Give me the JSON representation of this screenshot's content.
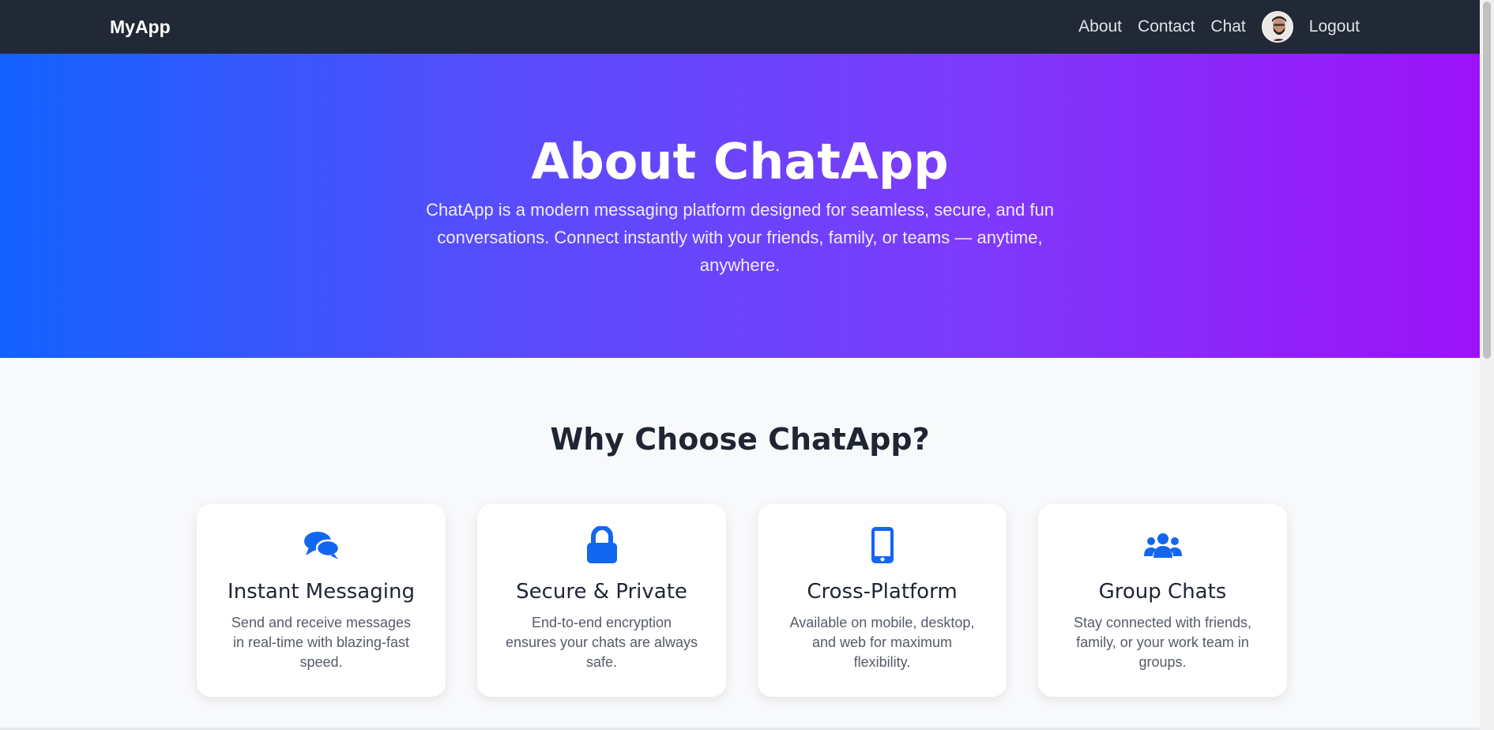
{
  "navbar": {
    "brand": "MyApp",
    "links": [
      {
        "label": "About"
      },
      {
        "label": "Contact"
      },
      {
        "label": "Chat"
      }
    ],
    "logout_label": "Logout",
    "avatar_icon": "user-avatar"
  },
  "hero": {
    "title": "About ChatApp",
    "text": "ChatApp is a modern messaging platform designed for seamless, secure, and fun conversations. Connect instantly with your friends, family, or teams — anytime, anywhere."
  },
  "features": {
    "title": "Why Choose ChatApp?",
    "accent_color": "#1366f0",
    "cards": [
      {
        "icon": "chat-bubbles-icon",
        "title": "Instant Messaging",
        "text": "Send and receive messages in real-time with blazing-fast speed."
      },
      {
        "icon": "lock-icon",
        "title": "Secure & Private",
        "text": "End-to-end encryption ensures your chats are always safe."
      },
      {
        "icon": "mobile-phone-icon",
        "title": "Cross-Platform",
        "text": "Available on mobile, desktop, and web for maximum flexibility."
      },
      {
        "icon": "users-group-icon",
        "title": "Group Chats",
        "text": "Stay connected with friends, family, or your work team in groups."
      }
    ]
  }
}
